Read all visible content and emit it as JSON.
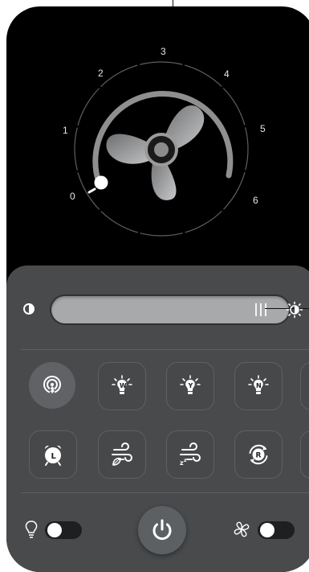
{
  "fan": {
    "speed_labels": [
      "0",
      "1",
      "2",
      "3",
      "4",
      "5",
      "6"
    ],
    "current_speed": 0
  },
  "brightness": {
    "level_percent": 92
  },
  "modes": {
    "row1": [
      {
        "name": "bluetooth-button"
      },
      {
        "name": "warm-light-button",
        "letter": "W"
      },
      {
        "name": "yellow-light-button",
        "letter": "Y"
      },
      {
        "name": "neutral-light-button",
        "letter": "N"
      }
    ],
    "row2": [
      {
        "name": "timer-button",
        "letter": "L"
      },
      {
        "name": "natural-breeze-button"
      },
      {
        "name": "sleep-breeze-button"
      },
      {
        "name": "reverse-button",
        "letter": "R"
      }
    ]
  },
  "toggles": {
    "light_on": false,
    "fan_on": false
  },
  "colors": {
    "card_bg": "#000000",
    "panel_bg": "#484a4c",
    "accent_white": "#ffffff"
  }
}
